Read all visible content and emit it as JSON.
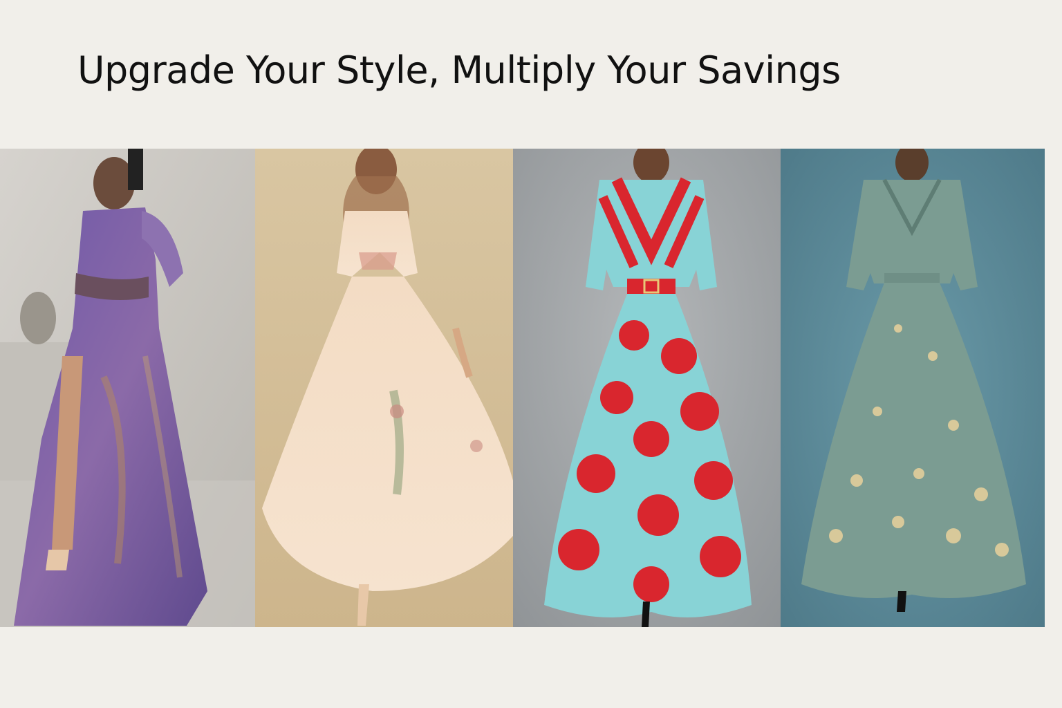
{
  "banner": {
    "headline": "Upgrade Your Style, Multiply Your Savings"
  },
  "gallery": {
    "items": [
      {
        "name": "purple-one-shoulder-gown",
        "colors": {
          "background": "#c9c6c1",
          "dress": "#7d5fa6",
          "accent": "#b58a5a"
        }
      },
      {
        "name": "blush-tulle-maxi-dress",
        "colors": {
          "background": "#d6c29c",
          "dress": "#f1d9bf",
          "accent": "#c98a80"
        }
      },
      {
        "name": "turquoise-red-floral-dress",
        "colors": {
          "background": "#9ea2a5",
          "dress": "#88d3d6",
          "accent": "#d9262e"
        }
      },
      {
        "name": "sage-embroidered-wrap-dress",
        "colors": {
          "background": "#5b8796",
          "dress": "#7b9c92",
          "accent": "#d8c99a"
        }
      }
    ]
  }
}
